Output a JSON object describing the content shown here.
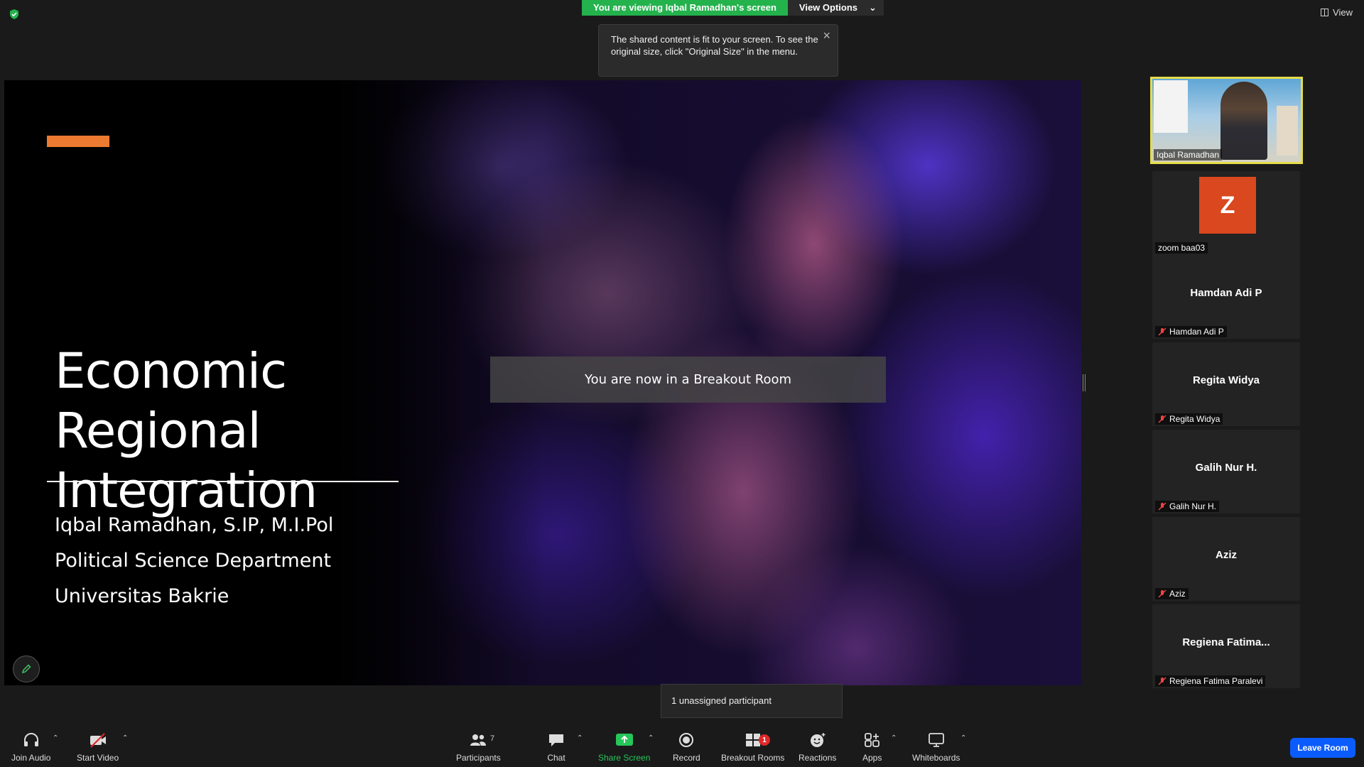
{
  "topbar": {
    "viewing_banner": "You are viewing Iqbal Ramadhan's screen",
    "view_options": "View Options",
    "view_button": "View"
  },
  "tooltip": {
    "text": "The shared content is fit to your screen. To see the original size, click \"Original Size\" in the menu."
  },
  "slide": {
    "title_line1": "Economic Regional",
    "title_line2": "Integration",
    "presenter": "Iqbal Ramadhan, S.IP, M.I.Pol",
    "department": "Political Science Department",
    "university": "Universitas Bakrie",
    "accent_color": "#ec7a30"
  },
  "breakout_message": "You are now in a Breakout Room",
  "unassigned_notice": "1 unassigned participant",
  "participants": [
    {
      "label": "Iqbal Ramadhan",
      "type": "video"
    },
    {
      "label": "zoom baa03",
      "avatar_letter": "Z",
      "avatar_color": "#d9481e"
    },
    {
      "name": "Hamdan Adi P",
      "label": "Hamdan Adi P",
      "muted": true
    },
    {
      "name": "Regita Widya",
      "label": "Regita Widya",
      "muted": true
    },
    {
      "name": "Galih Nur H.",
      "label": "Galih Nur H.",
      "muted": true
    },
    {
      "name": "Aziz",
      "label": "Aziz",
      "muted": true
    },
    {
      "name": "Regiena  Fatima...",
      "label": "Regiena Fatima Paralevi",
      "muted": true
    }
  ],
  "toolbar": {
    "join_audio": "Join Audio",
    "start_video": "Start Video",
    "participants": "Participants",
    "participants_count": "7",
    "chat": "Chat",
    "share_screen": "Share Screen",
    "record": "Record",
    "breakout_rooms": "Breakout Rooms",
    "breakout_badge": "1",
    "reactions": "Reactions",
    "apps": "Apps",
    "whiteboards": "Whiteboards",
    "leave_room": "Leave Room",
    "share_color": "#26c65a",
    "leave_color": "#0b5cff"
  }
}
